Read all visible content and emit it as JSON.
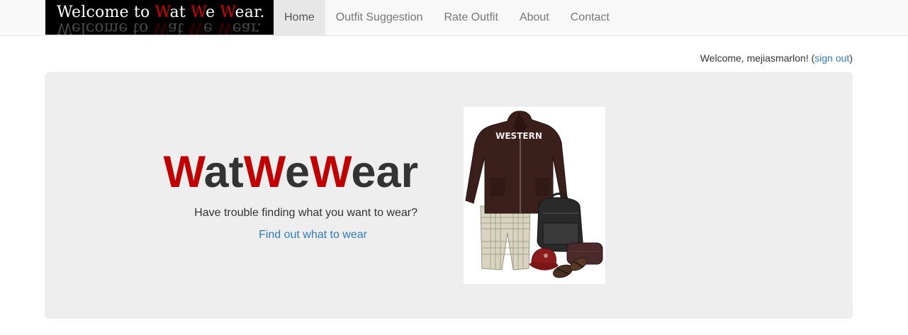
{
  "brand": {
    "parts": [
      "Welcome to ",
      "W",
      "at ",
      "W",
      "e ",
      "W",
      "ear."
    ]
  },
  "nav": {
    "items": [
      {
        "label": "Home",
        "active": true
      },
      {
        "label": "Outfit Suggestion",
        "active": false
      },
      {
        "label": "Rate Outfit",
        "active": false
      },
      {
        "label": "About",
        "active": false
      },
      {
        "label": "Contact",
        "active": false
      }
    ]
  },
  "user": {
    "welcome_prefix": "Welcome, mejiasmarlon! (",
    "sign_out": "sign out",
    "welcome_suffix": ")"
  },
  "hero": {
    "title_parts": [
      "W",
      "at",
      "W",
      "e",
      "W",
      "ear"
    ],
    "tagline": "Have trouble finding what you want to wear?",
    "cta": "Find out what to wear"
  },
  "outfit_image": {
    "hoodie_text": "WESTERN",
    "colors": {
      "hoodie": "#3a1f1a",
      "shorts": "#d9d4c2",
      "bag": "#2a2a2a",
      "cap": "#8a1c1c"
    }
  },
  "colors": {
    "accent_red": "#c00000",
    "link_blue": "#337ab7",
    "jumbotron_bg": "#eeeeee",
    "navbar_bg": "#f8f8f8"
  }
}
